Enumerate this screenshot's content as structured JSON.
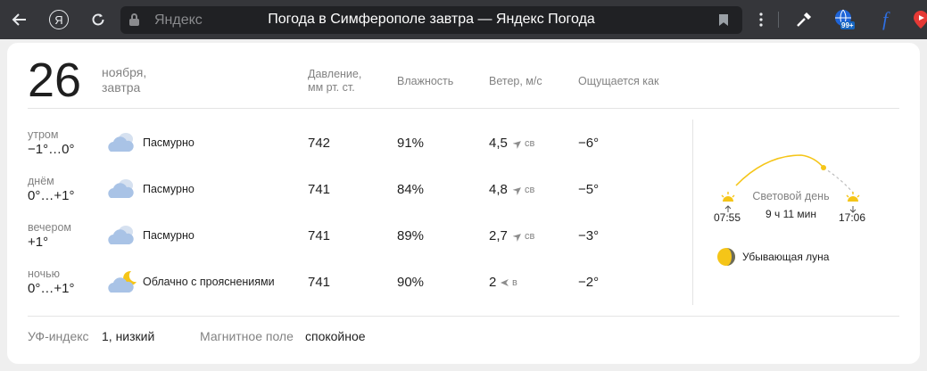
{
  "browser": {
    "site_name": "Яндекс",
    "page_title": "Погода в Симферополе завтра — Яндекс Погода",
    "yandex_button": "Я",
    "badge": "99+",
    "colors": {
      "toolbar": "#35363a",
      "omnibox": "#202124"
    }
  },
  "header": {
    "day": "26",
    "month": "ноября,",
    "relative": "завтра"
  },
  "columns": {
    "pressure": "Давление,",
    "pressure_unit": "мм рт. ст.",
    "humidity": "Влажность",
    "wind": "Ветер, м/с",
    "feels_like": "Ощущается как"
  },
  "rows": [
    {
      "part": "утром",
      "temp": "−1°…0°",
      "icon": "cloudy-icon",
      "condition": "Пасмурно",
      "pressure": "742",
      "humidity": "91%",
      "wind": "4,5",
      "wind_dir": "св",
      "feels": "−6°"
    },
    {
      "part": "днём",
      "temp": "0°…+1°",
      "icon": "cloudy-icon",
      "condition": "Пасмурно",
      "pressure": "741",
      "humidity": "84%",
      "wind": "4,8",
      "wind_dir": "св",
      "feels": "−5°"
    },
    {
      "part": "вечером",
      "temp": "+1°",
      "icon": "cloudy-icon",
      "condition": "Пасмурно",
      "pressure": "741",
      "humidity": "89%",
      "wind": "2,7",
      "wind_dir": "св",
      "feels": "−3°"
    },
    {
      "part": "ночью",
      "temp": "0°…+1°",
      "icon": "partly-cloudy-night-icon",
      "condition": "Облачно с прояснениями",
      "pressure": "741",
      "humidity": "90%",
      "wind": "2",
      "wind_dir": "в",
      "feels": "−2°"
    }
  ],
  "sun": {
    "label": "Световой день",
    "duration": "9 ч 11 мин",
    "sunrise": "07:55",
    "sunset": "17:06",
    "colors": {
      "arc": "#f5c518"
    }
  },
  "moon": {
    "label": "Убывающая луна"
  },
  "footer": {
    "uv_label": "УФ-индекс",
    "uv_value": "1, низкий",
    "magnetic_label": "Магнитное поле",
    "magnetic_value": "спокойное"
  }
}
